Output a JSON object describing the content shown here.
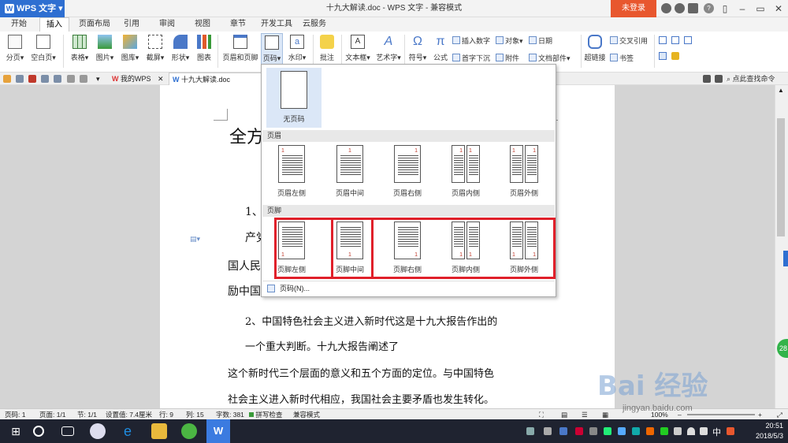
{
  "titlebar": {
    "app_name": "WPS 文字",
    "doc_title": "十九大解读.doc - WPS 文字 - 兼容模式",
    "login_label": "未登录"
  },
  "menu_tabs": [
    "开始",
    "插入",
    "页面布局",
    "引用",
    "审阅",
    "视图",
    "章节",
    "开发工具",
    "云服务"
  ],
  "ribbon": {
    "page_break": "分页",
    "blank_page": "空白页",
    "table": "表格",
    "picture": "图片",
    "gallery": "图库",
    "screenshot": "截屏",
    "shape": "形状",
    "chart": "图表",
    "header_footer": "页眉和页脚",
    "page_number": "页码",
    "watermark": "水印",
    "comment": "批注",
    "textbox": "文本框",
    "wordart": "艺术字",
    "symbol": "符号",
    "formula": "公式",
    "insert_number": "插入数字",
    "object": "对象",
    "date": "日期",
    "drop_cap": "首字下沉",
    "attachment": "附件",
    "doc_parts": "文档部件",
    "hyperlink": "超链接",
    "cross_ref": "交叉引用",
    "bookmark": "书签"
  },
  "quickbar": {
    "tab_mywps": "我的WPS",
    "tab_doc": "十九大解读.doc",
    "search_cmd": "点此查找命令"
  },
  "document": {
    "heading": "全方",
    "p1": "1、",
    "p2": "产党",
    "p3": "国人民",
    "p4": "励中国",
    "p5": "2、中国特色社会主义进入新时代这是十九大报告作出的",
    "p6": "一个重大判断。十九大报告阐述了",
    "p7": "这个新时代三个层面的意义和五个方面的定位。与中国特色",
    "p8": "社会主义进入新时代相应，我国社会主要矛盾也发生转化。"
  },
  "dropdown": {
    "no_page_number": "无页码",
    "header_section": "页眉",
    "header_options": [
      "页眉左侧",
      "页眉中间",
      "页眉右侧",
      "页眉内侧",
      "页眉外侧"
    ],
    "footer_section": "页脚",
    "footer_options": [
      "页脚左侧",
      "页脚中间",
      "页脚右侧",
      "页脚内侧",
      "页脚外侧"
    ],
    "more": "页码(N)...",
    "thumb_number": "1"
  },
  "status": {
    "page": "页码: 1",
    "pages": "页面: 1/1",
    "section": "节: 1/1",
    "setting": "设置值: 7.4厘米",
    "row": "行: 9",
    "col": "列: 15",
    "words": "字数: 381",
    "spell": "拼写检查",
    "compat": "兼容模式",
    "zoom": "100%"
  },
  "taskbar": {
    "ime": "中",
    "time": "20:51",
    "date": "2018/5/3"
  },
  "watermark": {
    "logo": "Bai 经验",
    "url": "jingyan.baidu.com"
  },
  "side_badge": "28",
  "colors": {
    "accent": "#2e6fd1",
    "login": "#e8572e",
    "highlight_box": "#e0202a",
    "selected_bg": "#dbe7f7"
  }
}
